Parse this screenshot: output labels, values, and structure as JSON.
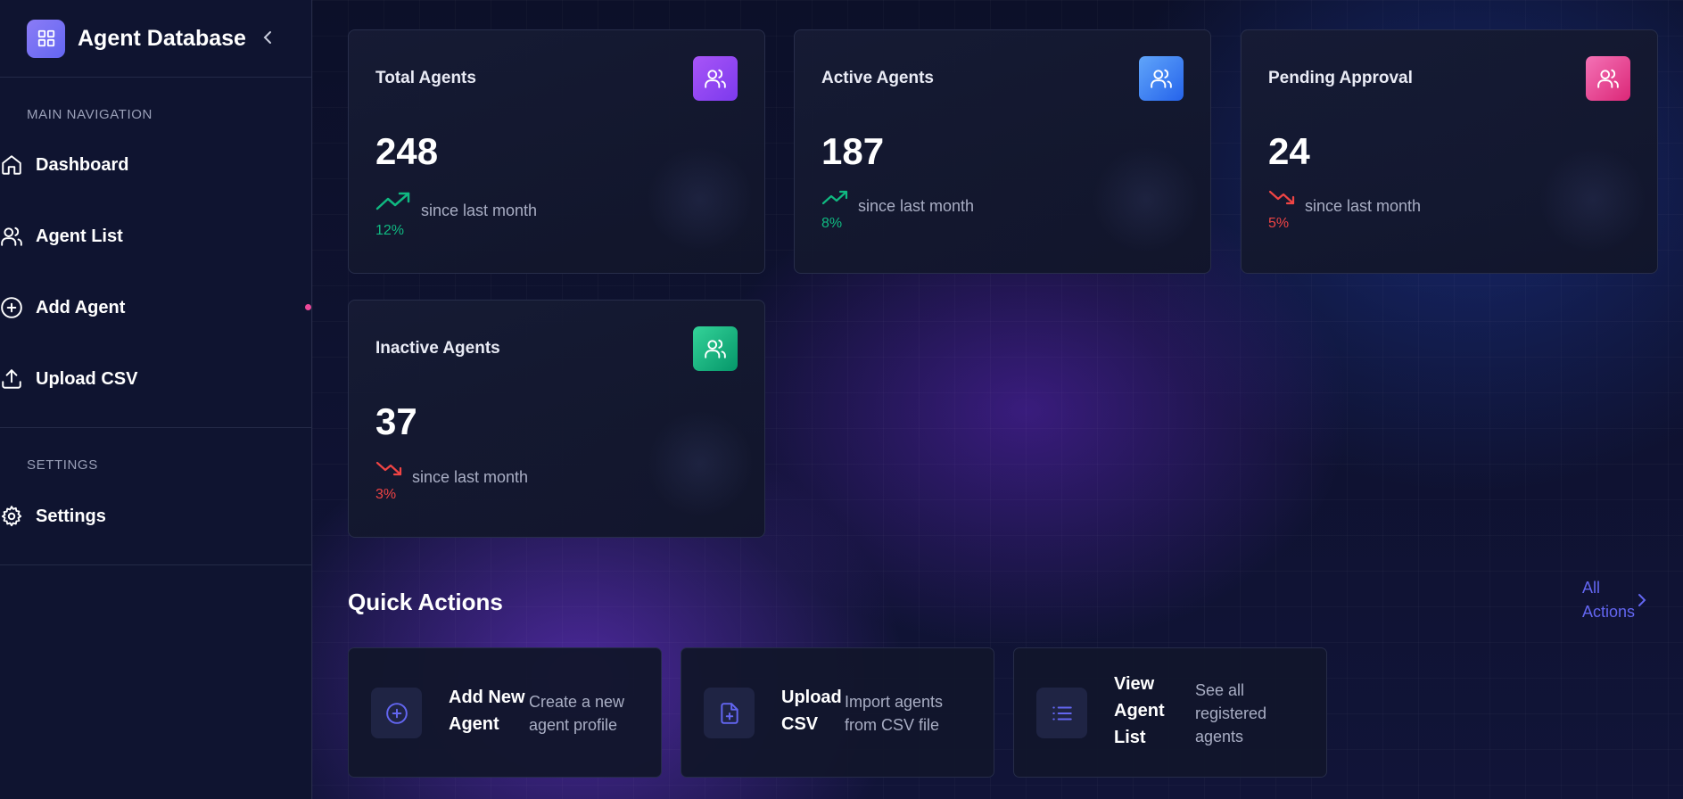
{
  "app": {
    "title": "Agent Database"
  },
  "sidebar": {
    "main_section": "MAIN NAVIGATION",
    "items": [
      {
        "label": "Dashboard",
        "icon": "home-icon"
      },
      {
        "label": "Agent List",
        "icon": "users-icon"
      },
      {
        "label": "Add Agent",
        "icon": "plus-circle-icon"
      },
      {
        "label": "Upload CSV",
        "icon": "upload-icon"
      }
    ],
    "settings_section": "SETTINGS",
    "settings_item": {
      "label": "Settings",
      "icon": "gear-icon"
    }
  },
  "stats": [
    {
      "title": "Total Agents",
      "value": "248",
      "trend": "up",
      "percent": "12%",
      "since": "since last month",
      "badge_color": "#7c3aed"
    },
    {
      "title": "Active Agents",
      "value": "187",
      "trend": "up",
      "percent": "8%",
      "since": "since last month",
      "badge_color": "#3b82f6"
    },
    {
      "title": "Pending Approval",
      "value": "24",
      "trend": "down",
      "percent": "5%",
      "since": "since last month",
      "badge_color": "#ec4899"
    },
    {
      "title": "Inactive Agents",
      "value": "37",
      "trend": "down",
      "percent": "3%",
      "since": "since last month",
      "badge_color": "#10b981"
    }
  ],
  "quick_actions": {
    "title": "Quick Actions",
    "all_label": "All Actions",
    "items": [
      {
        "name": "Add New Agent",
        "description": "Create a new agent profile",
        "icon": "plus-circle-icon"
      },
      {
        "name": "Upload CSV",
        "description": "Import agents from CSV file",
        "icon": "file-plus-icon"
      },
      {
        "name": "View Agent List",
        "description": "See all registered agents",
        "icon": "list-icon"
      }
    ]
  },
  "colors": {
    "accent": "#6366f1",
    "up": "#10b981",
    "down": "#ef4444",
    "sidebar_bg": "#0f1430",
    "active_dot": "#ec4899"
  }
}
